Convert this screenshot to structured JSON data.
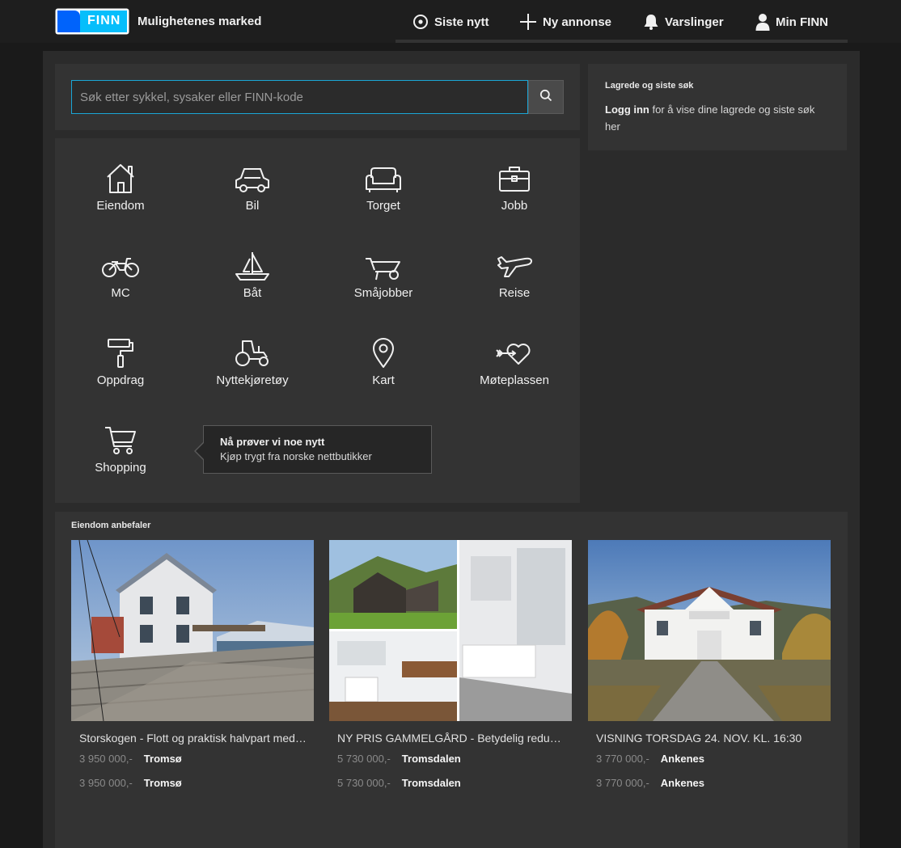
{
  "header": {
    "logo_text": "FINN",
    "tagline": "Mulighetenes marked",
    "nav": [
      {
        "label": "Siste nytt",
        "icon": "circle-dot-icon"
      },
      {
        "label": "Ny annonse",
        "icon": "plus-icon"
      },
      {
        "label": "Varslinger",
        "icon": "bell-icon"
      },
      {
        "label": "Min FINN",
        "icon": "user-icon"
      }
    ]
  },
  "search": {
    "placeholder": "Søk etter sykkel, sysaker eller FINN-kode",
    "value": ""
  },
  "saved": {
    "title": "Lagrede og siste søk",
    "login": "Logg inn",
    "text": " for å vise dine lagrede og siste søk her"
  },
  "categories": [
    {
      "label": "Eiendom",
      "icon": "house-icon"
    },
    {
      "label": "Bil",
      "icon": "car-icon"
    },
    {
      "label": "Torget",
      "icon": "sofa-icon"
    },
    {
      "label": "Jobb",
      "icon": "briefcase-icon"
    },
    {
      "label": "MC",
      "icon": "motorcycle-icon"
    },
    {
      "label": "Båt",
      "icon": "sailboat-icon"
    },
    {
      "label": "Småjobber",
      "icon": "wheelbarrow-icon"
    },
    {
      "label": "Reise",
      "icon": "airplane-icon"
    },
    {
      "label": "Oppdrag",
      "icon": "paint-roller-icon"
    },
    {
      "label": "Nyttekjøretøy",
      "icon": "tractor-icon"
    },
    {
      "label": "Kart",
      "icon": "map-pin-icon"
    },
    {
      "label": "Møteplassen",
      "icon": "heart-arrow-icon"
    },
    {
      "label": "Shopping",
      "icon": "shopping-cart-icon"
    }
  ],
  "tooltip": {
    "title": "Nå prøver vi noe nytt",
    "text": "Kjøp trygt fra norske nettbutikker"
  },
  "recommendations": {
    "title": "Eiendom anbefaler",
    "items": [
      {
        "title": "Storskogen - Flott og praktisk halvpart med sjøutsikt",
        "price": "3 950 000,-",
        "location": "Tromsø"
      },
      {
        "title": "NY PRIS GAMMELGÅRD - Betydelig redusert pris",
        "price": "5 730 000,-",
        "location": "Tromsdalen"
      },
      {
        "title": "VISNING TORSDAG 24. NOV. KL. 16:30",
        "price": "3 770 000,-",
        "location": "Ankenes"
      }
    ]
  },
  "colors": {
    "accent": "#1aa6d6",
    "logo_blue": "#0063fb",
    "background": "#1a1a1a",
    "panel": "#333333"
  }
}
